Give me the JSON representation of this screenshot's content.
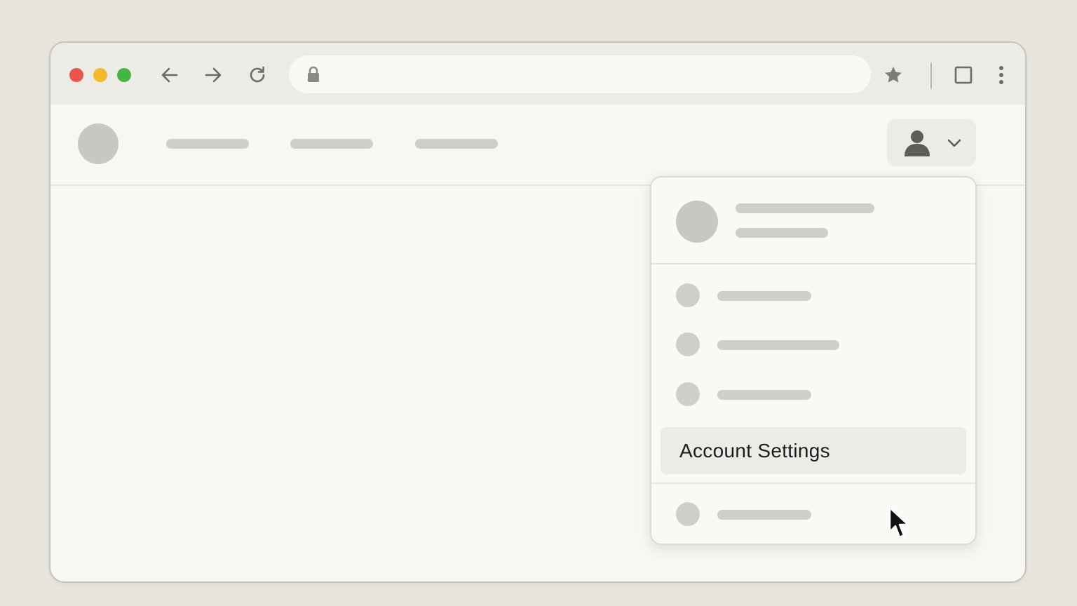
{
  "browser": {
    "traffic_lights": {
      "close_color": "#e8554a",
      "minimize_color": "#f2b92b",
      "maximize_color": "#43b543"
    },
    "icons": {
      "back": "arrow-left-icon",
      "forward": "arrow-right-icon",
      "reload": "reload-icon",
      "lock": "lock-icon",
      "bookmark": "star-icon",
      "tab_view": "square-icon",
      "menu": "more-vertical-icon"
    },
    "address_bar": {
      "value": ""
    }
  },
  "site": {
    "icons": {
      "account": "user-icon",
      "account_chevron": "chevron-down-icon"
    }
  },
  "account_menu": {
    "highlighted_item": {
      "label": "Account Settings"
    },
    "icons": {
      "cursor": "mouse-pointer-icon"
    }
  }
}
